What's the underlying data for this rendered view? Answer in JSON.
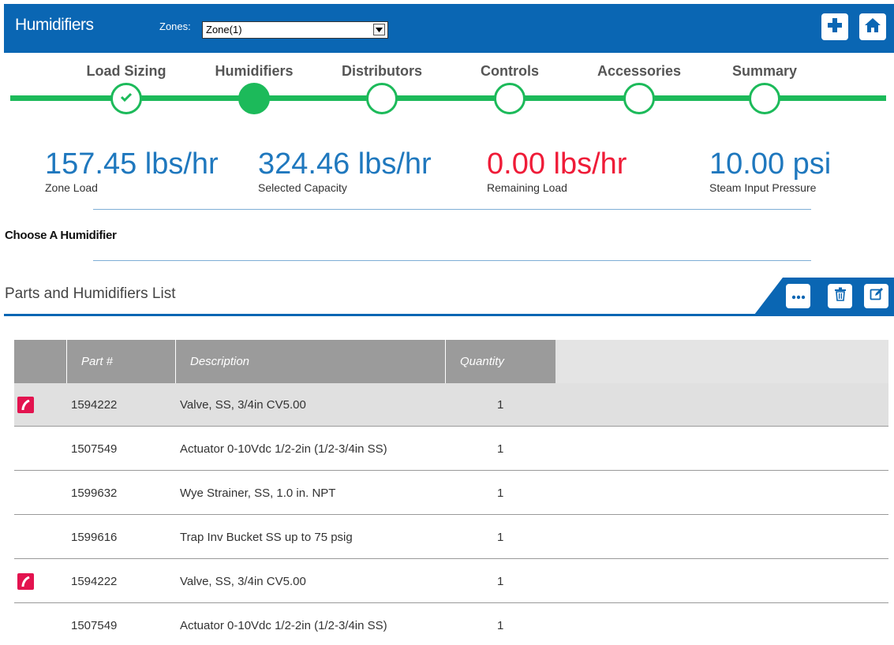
{
  "header": {
    "title": "Humidifiers",
    "zones_label": "Zones:",
    "zones_value": "Zone(1)",
    "add_icon": "plus-icon",
    "home_icon": "home-icon"
  },
  "stepper": {
    "steps": [
      {
        "label": "Load Sizing",
        "state": "complete"
      },
      {
        "label": "Humidifiers",
        "state": "active"
      },
      {
        "label": "Distributors",
        "state": "pending"
      },
      {
        "label": "Controls",
        "state": "pending"
      },
      {
        "label": "Accessories",
        "state": "pending"
      },
      {
        "label": "Summary",
        "state": "pending"
      }
    ]
  },
  "stats": [
    {
      "value": "157.45 lbs/hr",
      "label": "Zone Load",
      "color": "#1f78be"
    },
    {
      "value": "324.46 lbs/hr",
      "label": "Selected Capacity",
      "color": "#1f78be"
    },
    {
      "value": "0.00 lbs/hr",
      "label": "Remaining Load",
      "color": "#ef1c38"
    },
    {
      "value": "10.00 psi",
      "label": "Steam Input Pressure",
      "color": "#1f78be"
    }
  ],
  "choose_heading": "Choose A Humidifier",
  "parts": {
    "title": "Parts and Humidifiers List",
    "toolbar_icons": [
      "more-icon",
      "trash-icon",
      "edit-icon"
    ],
    "columns": [
      "Part #",
      "Description",
      "Quantity"
    ],
    "rows": [
      {
        "flag": true,
        "part": "1594222",
        "description": "Valve, SS, 3/4in CV5.00",
        "quantity": "1",
        "selected": true
      },
      {
        "flag": false,
        "part": "1507549",
        "description": "Actuator 0-10Vdc 1/2-2in (1/2-3/4in SS)",
        "quantity": "1",
        "selected": false
      },
      {
        "flag": false,
        "part": "1599632",
        "description": "Wye Strainer, SS, 1.0 in. NPT",
        "quantity": "1",
        "selected": false
      },
      {
        "flag": false,
        "part": "1599616",
        "description": "Trap Inv Bucket SS up to 75 psig",
        "quantity": "1",
        "selected": false
      },
      {
        "flag": true,
        "part": "1594222",
        "description": "Valve, SS, 3/4in CV5.00",
        "quantity": "1",
        "selected": false
      },
      {
        "flag": false,
        "part": "1507549",
        "description": "Actuator 0-10Vdc 1/2-2in (1/2-3/4in SS)",
        "quantity": "1",
        "selected": false
      }
    ]
  },
  "colors": {
    "brand_blue": "#0a66b3",
    "step_green": "#1cba5a",
    "flag_red": "#e3134f"
  }
}
